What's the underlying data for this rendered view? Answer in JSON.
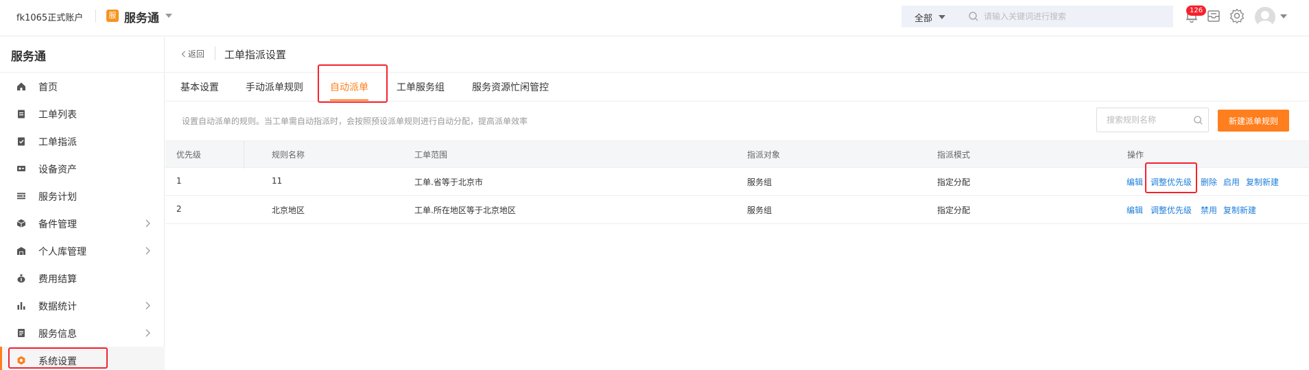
{
  "header": {
    "account": "fk1065正式账户",
    "app_name": "服务通",
    "app_logo_glyph": "服",
    "search_scope": "全部",
    "search_placeholder": "请输入关键词进行搜索",
    "notification_count": "126"
  },
  "sidebar": {
    "title": "服务通",
    "items": [
      {
        "label": "首页",
        "icon": "home-icon",
        "has_arrow": false
      },
      {
        "label": "工单列表",
        "icon": "clipboard-icon",
        "has_arrow": false
      },
      {
        "label": "工单指派",
        "icon": "assign-icon",
        "has_arrow": false
      },
      {
        "label": "设备资产",
        "icon": "device-icon",
        "has_arrow": false
      },
      {
        "label": "服务计划",
        "icon": "plan-icon",
        "has_arrow": false
      },
      {
        "label": "备件管理",
        "icon": "box-icon",
        "has_arrow": true
      },
      {
        "label": "个人库管理",
        "icon": "warehouse-icon",
        "has_arrow": true
      },
      {
        "label": "费用结算",
        "icon": "money-bag-icon",
        "has_arrow": false
      },
      {
        "label": "数据统计",
        "icon": "bar-chart-icon",
        "has_arrow": true
      },
      {
        "label": "服务信息",
        "icon": "document-icon",
        "has_arrow": true
      },
      {
        "label": "系统设置",
        "icon": "settings-icon",
        "has_arrow": false
      }
    ],
    "active_index": 10
  },
  "main": {
    "back_label": "返回",
    "page_title": "工单指派设置",
    "tabs": [
      {
        "label": "基本设置"
      },
      {
        "label": "手动派单规则"
      },
      {
        "label": "自动派单"
      },
      {
        "label": "工单服务组"
      },
      {
        "label": "服务资源忙闲管控"
      }
    ],
    "active_tab": 2,
    "description": "设置自动派单的规则。当工单需自动指派时，会按照预设派单规则进行自动分配，提高派单效率",
    "rule_search_placeholder": "搜索规则名称",
    "new_rule_button": "新建派单规则",
    "table": {
      "headers": [
        "优先级",
        "规则名称",
        "工单范围",
        "指派对象",
        "指派模式",
        "操作"
      ],
      "rows": [
        {
          "priority": "1",
          "name": "11",
          "scope": "工单.省等于北京市",
          "target": "服务组",
          "mode": "指定分配",
          "ops": [
            "编辑",
            "调整优先级",
            "删除",
            "启用",
            "复制新建"
          ]
        },
        {
          "priority": "2",
          "name": "北京地区",
          "scope": "工单.所在地区等于北京地区",
          "target": "服务组",
          "mode": "指定分配",
          "ops": [
            "编辑",
            "调整优先级",
            "禁用",
            "复制新建"
          ]
        }
      ]
    }
  },
  "colors": {
    "accent": "#ff7e1d",
    "link": "#1f7fdb",
    "highlight": "#f5222d"
  }
}
